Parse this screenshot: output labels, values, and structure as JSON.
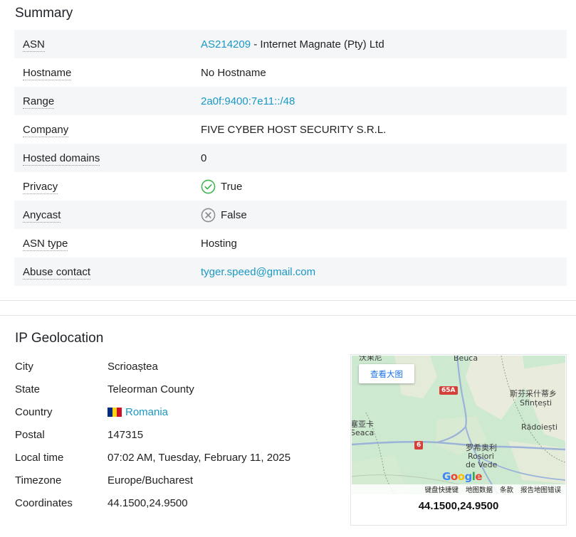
{
  "summary": {
    "title": "Summary",
    "rows": [
      {
        "key": "ASN",
        "link": "AS214209",
        "value": " - Internet Magnate (Pty) Ltd"
      },
      {
        "key": "Hostname",
        "value": "No Hostname"
      },
      {
        "key": "Range",
        "link": "2a0f:9400:7e11::/48"
      },
      {
        "key": "Company",
        "value": "FIVE CYBER HOST SECURITY S.R.L."
      },
      {
        "key": "Hosted domains",
        "value": "0"
      },
      {
        "key": "Privacy",
        "value": "True",
        "icon": "check-circle-icon"
      },
      {
        "key": "Anycast",
        "value": "False",
        "icon": "x-circle-icon"
      },
      {
        "key": "ASN type",
        "value": "Hosting"
      },
      {
        "key": "Abuse contact",
        "link": "tyger.speed@gmail.com"
      }
    ]
  },
  "geolocation": {
    "title": "IP Geolocation",
    "rows": [
      {
        "key": "City",
        "value": "Scrioaștea"
      },
      {
        "key": "State",
        "value": "Teleorman County"
      },
      {
        "key": "Country",
        "value": "Romania",
        "icon": "romania-flag-icon"
      },
      {
        "key": "Postal",
        "value": "147315"
      },
      {
        "key": "Local time",
        "value": "07:02 AM, Tuesday, February 11, 2025"
      },
      {
        "key": "Timezone",
        "value": "Europe/Bucharest"
      },
      {
        "key": "Coordinates",
        "value": "44.1500,24.9500"
      }
    ]
  },
  "map": {
    "view_larger": "查看大图",
    "labels": {
      "top_left": "沃果尼",
      "top_center": "Beuca",
      "right_cn": "斯芬采什蒂乡",
      "right_ro": "Sfințești",
      "radoiesti": "Rădoiești",
      "left_cn": "塞亚卡",
      "left_ro": "Seaca",
      "center_cn": "罗希奥利",
      "center_ro1": "Roșiori",
      "center_ro2": "de Vede"
    },
    "roads": {
      "r1": "65A",
      "r2": "6"
    },
    "google": "Google",
    "footer": [
      "键盘快捷键",
      "地图数据",
      "条款",
      "报告地图错误"
    ],
    "coordinates": "44.1500,24.9500"
  },
  "colors": {
    "link": "#1a98c6",
    "row_alt": "#f4f6f7",
    "check": "#3fb34f",
    "cross": "#8a8f94",
    "flag": [
      "#002b7f",
      "#fcd116",
      "#ce1126"
    ]
  }
}
